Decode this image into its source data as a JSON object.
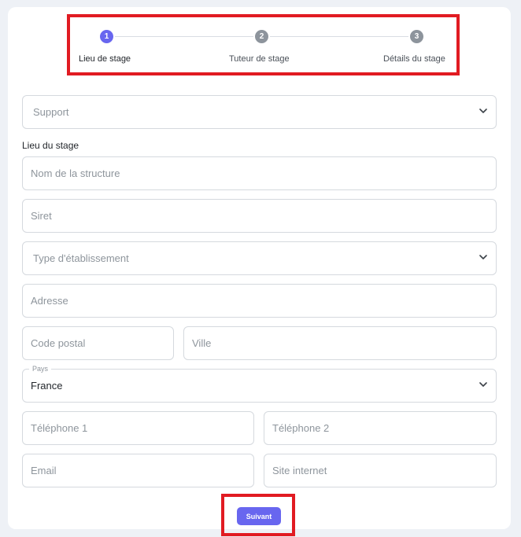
{
  "stepper": {
    "steps": [
      {
        "number": "1",
        "label": "Lieu de stage",
        "state": "active"
      },
      {
        "number": "2",
        "label": "Tuteur de stage",
        "state": "todo"
      },
      {
        "number": "3",
        "label": "Détails du stage",
        "state": "todo"
      }
    ]
  },
  "form": {
    "support_placeholder": "Support",
    "section_title": "Lieu du stage",
    "nom_structure_placeholder": "Nom de la structure",
    "siret_placeholder": "Siret",
    "type_etablissement_placeholder": "Type d'établissement",
    "adresse_placeholder": "Adresse",
    "code_postal_placeholder": "Code postal",
    "ville_placeholder": "Ville",
    "pays_label": "Pays",
    "pays_value": "France",
    "telephone1_placeholder": "Téléphone 1",
    "telephone2_placeholder": "Téléphone 2",
    "email_placeholder": "Email",
    "site_placeholder": "Site internet"
  },
  "actions": {
    "next_label": "Suivant"
  },
  "colors": {
    "accent": "#6866ef",
    "highlight": "#e11b22",
    "inactive_step": "#8d949c"
  }
}
